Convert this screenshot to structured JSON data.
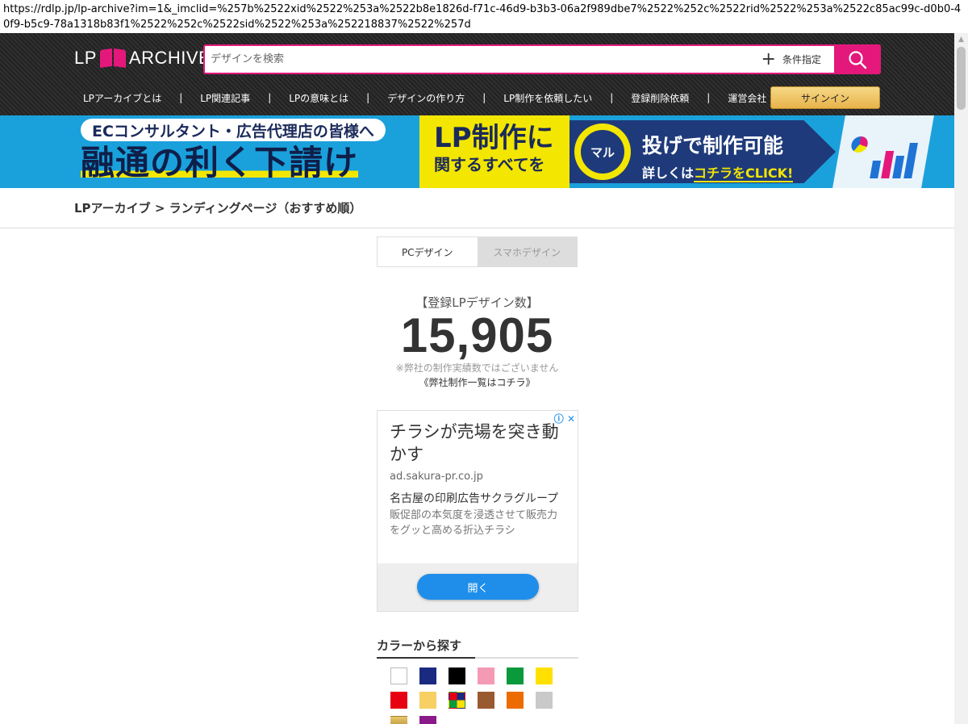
{
  "browser": {
    "url": "https://rdlp.jp/lp-archive?im=1&_imclid=%257b%2522xid%2522%253a%2522b8e1826d-f71c-46d9-b3b3-06a2f989dbe7%2522%252c%2522rid%2522%253a%2522c85ac99c-d0b0-40f9-b5c9-78a1318b83f1%2522%252c%2522sid%2522%253a%252218837%2522%257d"
  },
  "header": {
    "logo_left": "LP",
    "logo_right": "ARCHIVE",
    "search_placeholder": "デザインを検索",
    "condition_label": "条件指定",
    "nav": [
      "LPアーカイブとは",
      "LP関連記事",
      "LPの意味とは",
      "デザインの作り方",
      "LP制作を依頼したい",
      "登録削除依頼",
      "運営会社"
    ],
    "nav_separator": "|",
    "signin_label": "サインイン",
    "accent_color": "#e4187b"
  },
  "banner": {
    "subtitle": "ECコンサルタント・広告代理店の皆様へ",
    "headline": "融通の利く下請け",
    "mid_line1": "LP制作に",
    "mid_line2": "関するすべてを",
    "circle": "マル",
    "right_line1": "投げで制作可能",
    "right_line2_prefix": "詳しくは",
    "right_line2_link": "コチラをCLICK!"
  },
  "breadcrumb": "LPアーカイブ > ランディングページ（おすすめ順）",
  "tabs": {
    "pc": "PCデザイン",
    "sp": "スマホデザイン"
  },
  "stats": {
    "label": "【登録LPデザイン数】",
    "count": "15,905",
    "note": "※弊社の制作実績数ではございません",
    "link": "《弊社制作一覧はコチラ》"
  },
  "ad": {
    "title": "チラシが売場を突き動かす",
    "domain": "ad.sakura-pr.co.jp",
    "company": "名古屋の印刷広告サクラグループ",
    "description": "販促部の本気度を浸透させて販売力をグッと高める折込チラシ",
    "open_label": "開く",
    "icons": "ⓘ ✕"
  },
  "colors": {
    "heading": "カラーから探す",
    "swatches": [
      {
        "name": "white",
        "color": "#ffffff"
      },
      {
        "name": "navy",
        "color": "#1a2a80"
      },
      {
        "name": "black",
        "color": "#000000"
      },
      {
        "name": "pink",
        "color": "#f59ab5"
      },
      {
        "name": "green",
        "color": "#0a9a3c"
      },
      {
        "name": "yellow",
        "color": "#ffe000"
      },
      {
        "name": "red",
        "color": "#e60012"
      },
      {
        "name": "beige",
        "color": "#f7cf62"
      },
      {
        "name": "multi",
        "color": "multi"
      },
      {
        "name": "brown",
        "color": "#9a5a30"
      },
      {
        "name": "orange",
        "color": "#ec6c00"
      },
      {
        "name": "gray",
        "color": "#c9c9c9"
      },
      {
        "name": "gold",
        "color": "#c8a040"
      },
      {
        "name": "purple",
        "color": "#8a1a8a"
      }
    ]
  }
}
